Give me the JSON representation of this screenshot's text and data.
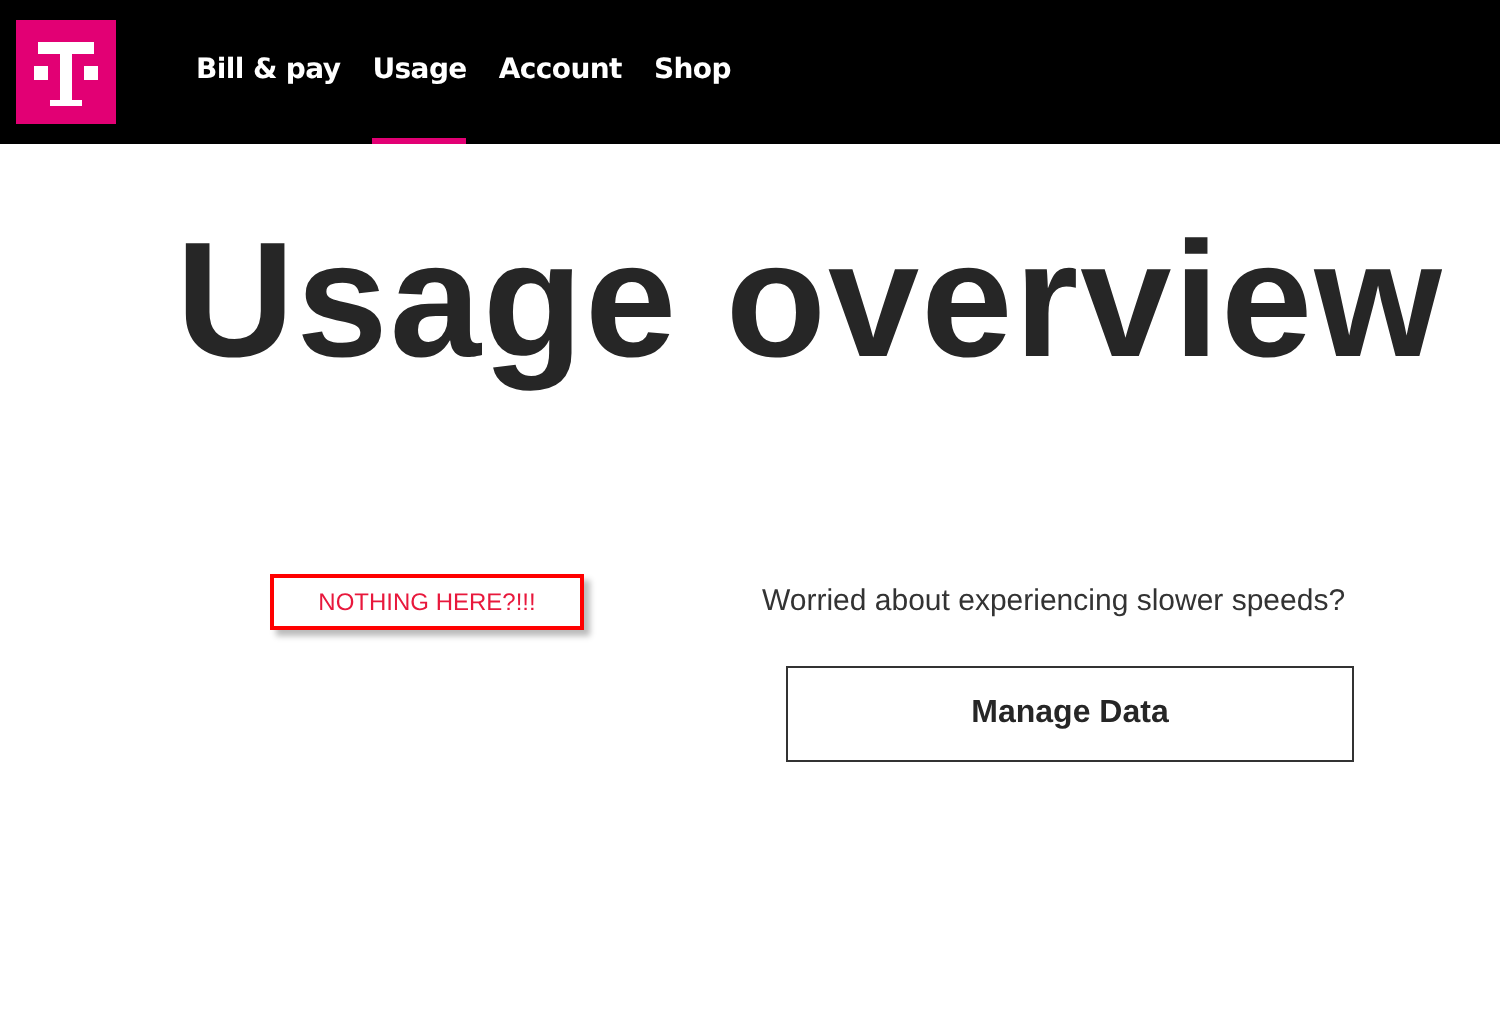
{
  "nav": {
    "items": [
      {
        "label": "Bill & pay",
        "selected": false
      },
      {
        "label": "Usage",
        "selected": true
      },
      {
        "label": "Account",
        "selected": false
      },
      {
        "label": "Shop",
        "selected": false
      }
    ]
  },
  "page_title": "Usage overview",
  "annotation": "NOTHING HERE?!!!",
  "data_prompt": {
    "text": "Worried about experiencing slower speeds?",
    "button": "Manage Data"
  }
}
